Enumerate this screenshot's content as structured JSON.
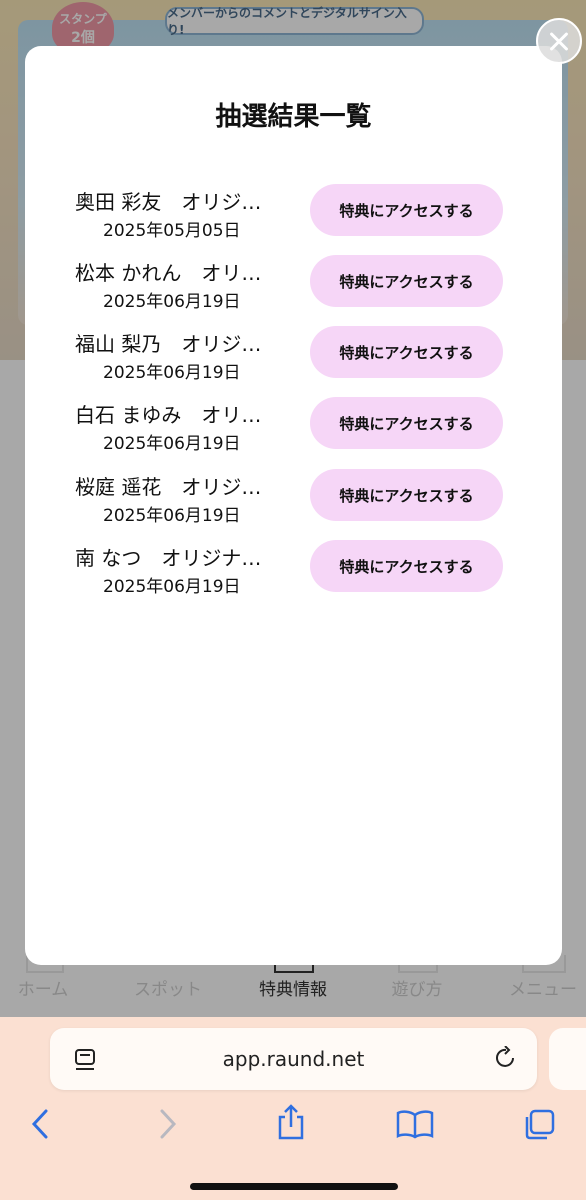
{
  "background": {
    "banner_tagline": "メンバーからのコメントとデジタルサイン入り!",
    "stamp_label": "スタンプ",
    "stamp_count": "2個"
  },
  "modal": {
    "title": "抽選結果一覧",
    "rows": [
      {
        "name": "奥田 彩友　オリジ…",
        "date": "2025年05月05日",
        "button": "特典にアクセスする"
      },
      {
        "name": "松本 かれん　オリ…",
        "date": "2025年06月19日",
        "button": "特典にアクセスする"
      },
      {
        "name": "福山 梨乃　オリジ…",
        "date": "2025年06月19日",
        "button": "特典にアクセスする"
      },
      {
        "name": "白石 まゆみ　オリ…",
        "date": "2025年06月19日",
        "button": "特典にアクセスする"
      },
      {
        "name": "桜庭 遥花　オリジ…",
        "date": "2025年06月19日",
        "button": "特典にアクセスする"
      },
      {
        "name": "南 なつ　オリジナ…",
        "date": "2025年06月19日",
        "button": "特典にアクセスする"
      }
    ]
  },
  "tabbar": {
    "items": [
      {
        "label": "ホーム"
      },
      {
        "label": "スポット"
      },
      {
        "label": "特典情報"
      },
      {
        "label": "遊び方"
      },
      {
        "label": "メニュー"
      }
    ],
    "active_index": 2
  },
  "browser": {
    "url": "app.raund.net",
    "accent_color": "#2f6fe0",
    "chrome_color": "#fbe0d2"
  }
}
